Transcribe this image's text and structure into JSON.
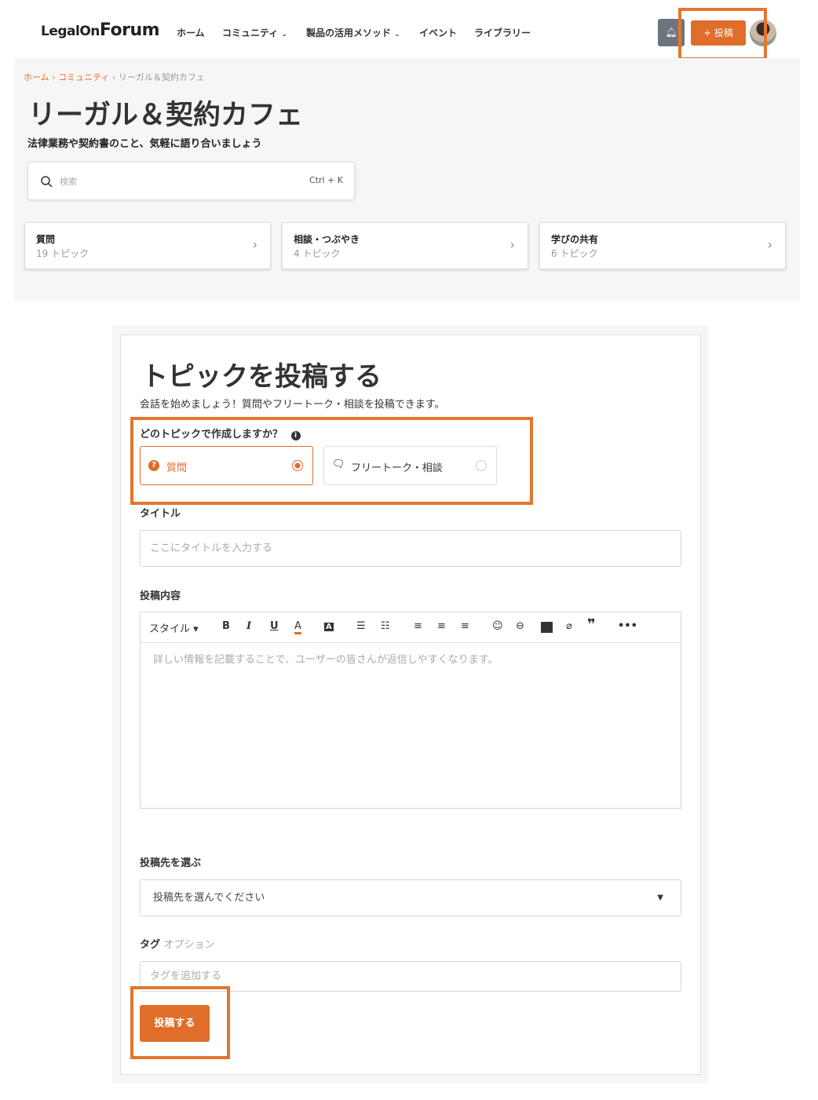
{
  "header": {
    "logo_a": "LegalOn",
    "logo_b": "Forum",
    "nav": [
      "ホーム",
      "コミュニティ",
      "製品の活用メソッド",
      "イベント",
      "ライブラリー"
    ],
    "post_button": "+ 投稿"
  },
  "breadcrumb": [
    "ホーム",
    "コミュニティ",
    "リーガル＆契約カフェ"
  ],
  "page": {
    "title": "リーガル＆契約カフェ",
    "subtitle": "法律業務や契約書のこと、気軽に語り合いましょう"
  },
  "search": {
    "placeholder": "検索",
    "shortcut": "Ctrl + K"
  },
  "categories": [
    {
      "name": "質問",
      "count": "19 トピック"
    },
    {
      "name": "相談・つぶやき",
      "count": "4 トピック"
    },
    {
      "name": "学びの共有",
      "count": "6 トピック"
    }
  ],
  "form": {
    "title": "トピックを投稿する",
    "subtitle": "会話を始めましょう！質問やフリートーク・相談を投稿できます。",
    "type_label": "どのトピックで作成しますか？",
    "types": [
      "質問",
      "フリートーク・相談"
    ],
    "title_label": "タイトル",
    "title_placeholder": "ここにタイトルを入力する",
    "content_label": "投稿内容",
    "style_label": "スタイル",
    "content_placeholder": "詳しい情報を記載することで、ユーザーの皆さんが返信しやすくなります。",
    "dest_label": "投稿先を選ぶ",
    "dest_placeholder": "投稿先を選んでください",
    "tag_label": "タグ",
    "tag_optional": "オプション",
    "tag_placeholder": "タグを追加する",
    "submit": "投稿する"
  },
  "colors": {
    "accent": "#e06d2a",
    "annotation": "#e4762f"
  }
}
